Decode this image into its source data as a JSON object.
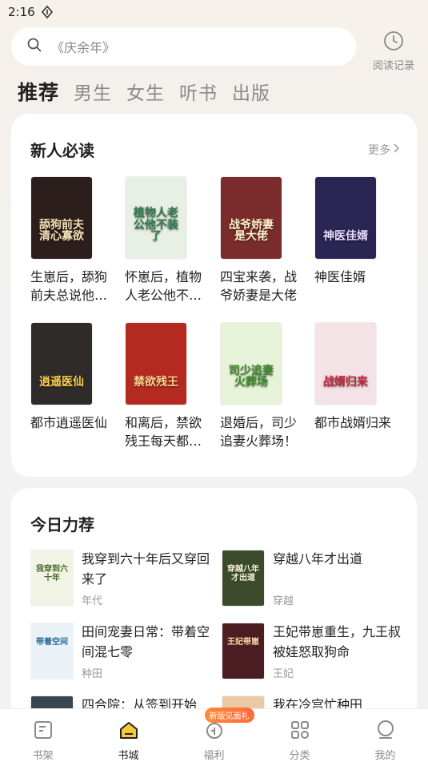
{
  "status": {
    "time": "2:16"
  },
  "search": {
    "placeholder": "《庆余年》",
    "history_label": "阅读记录"
  },
  "tabs": [
    "推荐",
    "男生",
    "女生",
    "听书",
    "出版"
  ],
  "new_reader": {
    "title": "新人必读",
    "more_label": "更多",
    "books": [
      {
        "name": "生崽后，舔狗前夫总说他不…",
        "cover_text": "舔狗前夫清心寡欲",
        "cover_bg": "#2c1e1c",
        "cover_fg": "#f5e1b6"
      },
      {
        "name": "怀崽后，植物人老公他不…",
        "cover_text": "植物人老公他不装了",
        "cover_bg": "#e8f0e6",
        "cover_fg": "#2f7a4d"
      },
      {
        "name": "四宝来袭，战爷娇妻是大佬",
        "cover_text": "战爷娇妻是大佬",
        "cover_bg": "#7a2c2c",
        "cover_fg": "#fff1c9"
      },
      {
        "name": "神医佳婿",
        "cover_text": "神医佳婿",
        "cover_bg": "#2a2552",
        "cover_fg": "#e6dcff"
      },
      {
        "name": "都市逍遥医仙",
        "cover_text": "逍遥医仙",
        "cover_bg": "#2e2b2a",
        "cover_fg": "#ffd34a"
      },
      {
        "name": "和离后，禁欲残王每天都…",
        "cover_text": "禁欲残王",
        "cover_bg": "#b42a20",
        "cover_fg": "#ffd890"
      },
      {
        "name": "退婚后，司少追妻火葬场！",
        "cover_text": "司少追妻火葬场",
        "cover_bg": "#e7f3d8",
        "cover_fg": "#3d8a2b"
      },
      {
        "name": "都市战婿归来",
        "cover_text": "战婿归来",
        "cover_bg": "#f4e3e6",
        "cover_fg": "#c3243a"
      }
    ]
  },
  "today": {
    "title": "今日力荐",
    "items": [
      {
        "title": "我穿到六十年后又穿回来了",
        "tag": "年代",
        "cover_text": "我穿到六十年",
        "cover_bg": "#f1f4e4",
        "cover_fg": "#4a6a2b"
      },
      {
        "title": "穿越八年才出道",
        "tag": "穿越",
        "cover_text": "穿越八年才出道",
        "cover_bg": "#3b4a2a",
        "cover_fg": "#f3f1d8"
      },
      {
        "title": "田间宠妻日常：带着空间混七零",
        "tag": "种田",
        "cover_text": "带着空间",
        "cover_bg": "#eaf2f7",
        "cover_fg": "#2a6a9a"
      },
      {
        "title": "王妃带崽重生，九王叔被娃怒取狗命",
        "tag": "王妃",
        "cover_text": "王妃带崽",
        "cover_bg": "#4a1e22",
        "cover_fg": "#ffd9a6"
      },
      {
        "title": "四合院：从签到开始",
        "tag": "",
        "cover_text": "",
        "cover_bg": "#3a4552",
        "cover_fg": "#fff"
      },
      {
        "title": "我在冷宫忙种田",
        "tag": "",
        "cover_text": "",
        "cover_bg": "#e9c9a6",
        "cover_fg": "#fff"
      }
    ]
  },
  "bottom_nav": {
    "items": [
      "书架",
      "书城",
      "福利",
      "分类",
      "我的"
    ],
    "badge": "新版见面礼"
  }
}
